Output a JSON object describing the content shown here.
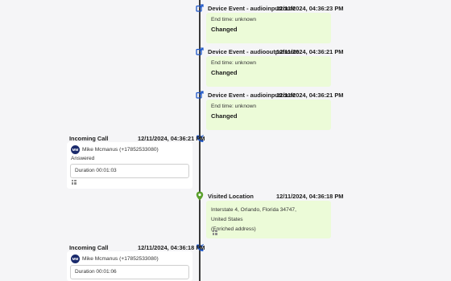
{
  "events": [
    {
      "title": "Device Event - audioinputroute",
      "time": "12/11/2024, 04:36:23 PM",
      "end_time": "End time: unknown",
      "status": "Changed"
    },
    {
      "title": "Device Event - audiooutputroute",
      "time": "12/11/2024, 04:36:21 PM",
      "end_time": "End time: unknown",
      "status": "Changed"
    },
    {
      "title": "Device Event - audioinputroute",
      "time": "12/11/2024, 04:36:21 PM",
      "end_time": "End time: unknown",
      "status": "Changed"
    }
  ],
  "calls": [
    {
      "title": "Incoming Call",
      "time": "12/11/2024, 04:36:21 PM",
      "initials": "MM",
      "contact": "Mike Mcmanus (+17852533080)",
      "state": "Answered",
      "duration": "Duration 00:01:03"
    },
    {
      "title": "Incoming Call",
      "time": "12/11/2024, 04:36:18 PM",
      "initials": "MM",
      "contact": "Mike Mcmanus (+17852533080)",
      "duration": "Duration 00:01:06"
    }
  ],
  "location": {
    "title": "Visited Location",
    "time": "12/11/2024, 04:36:18 PM",
    "address": "Interstate 4, Orlando, Florida 34747, United States",
    "note": "(Enriched address)"
  },
  "colors": {
    "event_bg": "#ecfbd8",
    "icon_blue": "#1e56c8",
    "pin_green": "#5aa02c",
    "avatar": "#1a2a6c"
  }
}
